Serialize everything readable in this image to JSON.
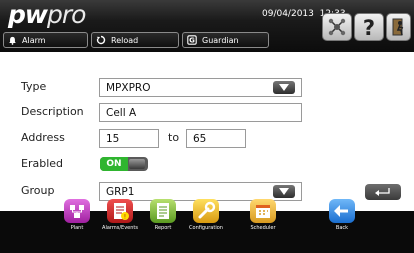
{
  "header": {
    "logo_primary": "pw",
    "logo_secondary": "pro",
    "date": "09/04/2013",
    "time": "12:33",
    "buttons": [
      {
        "label": "Alarm",
        "icon": "bell-icon"
      },
      {
        "label": "Reload",
        "icon": "reload-icon"
      },
      {
        "label": "Guardian",
        "icon": "guardian-icon"
      }
    ],
    "square_buttons": [
      {
        "icon": "network-icon"
      },
      {
        "icon": "help-icon"
      },
      {
        "icon": "exit-icon"
      }
    ]
  },
  "form": {
    "type": {
      "label": "Type",
      "value": "MPXPRO"
    },
    "description": {
      "label": "Description",
      "value": "Cell A"
    },
    "address": {
      "label": "Address",
      "from": "15",
      "to_label": "to",
      "to": "65"
    },
    "enabled": {
      "label": "Erabled",
      "value": "ON"
    },
    "group": {
      "label": "Group",
      "value": "GRP1"
    }
  },
  "nav": [
    {
      "label": "Plant",
      "color": "#c040c0"
    },
    {
      "label": "Alarms/Events",
      "color": "#d43030"
    },
    {
      "label": "Report",
      "color": "#7dbb3a"
    },
    {
      "label": "Configuration",
      "color": "#e8b820"
    },
    {
      "label": "Scheduler",
      "color": "#e6b830"
    },
    {
      "label": "Back",
      "color": "#2f8fe0"
    }
  ]
}
